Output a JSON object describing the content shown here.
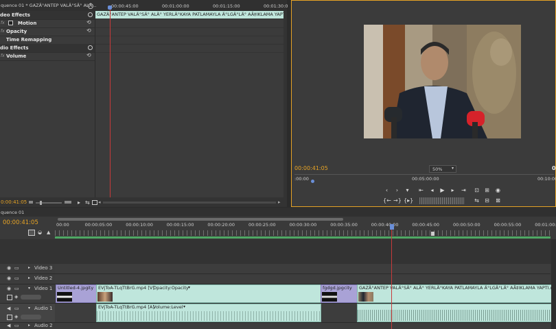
{
  "effect_controls": {
    "sequence_tab": "quence 01 * GAZÄ°ANTEP VALÄ°SÄ° ALÄ...",
    "timecodes": [
      "00:00:45:00",
      "00:01:00:00",
      "00:01:15:00",
      "00:01:30:0"
    ],
    "clip_name": "GAZÄ°ANTEP VALÄ°SÄ° ALÄ° YERLÄ°KAYA PATLAMAYLA Ä°LGÄ°LÄ° AÃ‡IKLAMA YAPTI.mp4",
    "rows": {
      "video_effects": "deo Effects",
      "motion": "Motion",
      "opacity": "Opacity",
      "time_remapping": "Time Remapping",
      "audio_effects": "dio Effects",
      "volume": "Volume"
    },
    "current_time": "0:00:41:05"
  },
  "program_monitor": {
    "current_time": "00:00:41:05",
    "zoom": "50%",
    "ruler_mid": "00:05:00:00",
    "ruler_end": "00:10:00:",
    "right_label": "0"
  },
  "timeline": {
    "tab": "quence 01",
    "current_time": "00:00:41:05",
    "ruler": [
      "00:00",
      "00:00:05:00",
      "00:00:10:00",
      "00:00:15:00",
      "00:00:20:00",
      "00:00:25:00",
      "00:00:30:00",
      "00:00:35:00",
      "00:00:40:00",
      "00:00:45:00",
      "00:00:50:00",
      "00:00:55:00",
      "00:01:00:0"
    ],
    "tracks": {
      "video3": "Video 3",
      "video2": "Video 2",
      "video1": "Video 1",
      "audio1": "Audio 1",
      "audio2": "Audio 2"
    },
    "clips": {
      "v_untitled": "Untitled-4.jpg",
      "v_untitled_suffix": "ity",
      "v_eyj": "EVjToA-TLqTtBrG.mp4 [V]",
      "v_eyj_fx": "Opacity:Opacity",
      "v_fgdgd": "fgdgd.jpg",
      "v_fgdgd_suffix": "city",
      "v_gaz": "GAZÄ°ANTEP VALÄ°SÄ° ALÄ° YERLÄ°KAYA PATLAMAYLA Ä°LGÄ°LÄ° AÃ‡IKLAMA YAPTI.mp4 [V]",
      "a_eyj": "EVjToA-TLqTtBrG.mp4 [A]",
      "a_eyj_fx": "Volume:Level"
    }
  },
  "colors": {
    "accent": "#e8a425",
    "playhead": "#c83a3a",
    "video_clip": "#a9a2d6",
    "media_clip": "#bfe6dc"
  }
}
